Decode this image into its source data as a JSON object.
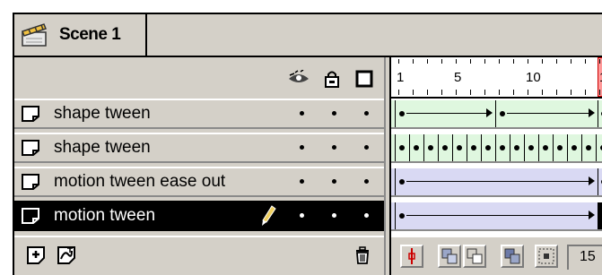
{
  "scene": {
    "label": "Scene 1"
  },
  "header_icons": [
    "eye-icon",
    "lock-icon",
    "outline-icon"
  ],
  "layers": [
    {
      "name": "shape tween",
      "selected": false,
      "tween": "shape",
      "show": "•",
      "lock": "•",
      "outline": "•"
    },
    {
      "name": "shape tween",
      "selected": false,
      "tween": "shape-keyframes",
      "show": "•",
      "lock": "•",
      "outline": "•"
    },
    {
      "name": "motion tween ease out",
      "selected": false,
      "tween": "motion",
      "show": "•",
      "lock": "•",
      "outline": "•"
    },
    {
      "name": "motion tween",
      "selected": true,
      "tween": "motion",
      "show": "•",
      "lock": "•",
      "outline": "•"
    }
  ],
  "ruler": {
    "labels": [
      "1",
      "5",
      "10",
      "1"
    ]
  },
  "footer": {
    "left_buttons": [
      "insert-layer-icon",
      "add-motion-guide-icon"
    ],
    "delete_button": "trash-icon",
    "frame_buttons": [
      "center-frame-icon",
      "onion-skin-icon",
      "onion-skin-outlines-icon",
      "edit-multiple-frames-icon",
      "modify-onion-markers-icon"
    ],
    "current_frame": "15"
  },
  "colors": {
    "panel": "#d4d0c8",
    "shape_tween": "#dff7df",
    "motion_tween": "#d9d9f3",
    "playhead": "#ff9999",
    "selected_row": "#000000"
  }
}
